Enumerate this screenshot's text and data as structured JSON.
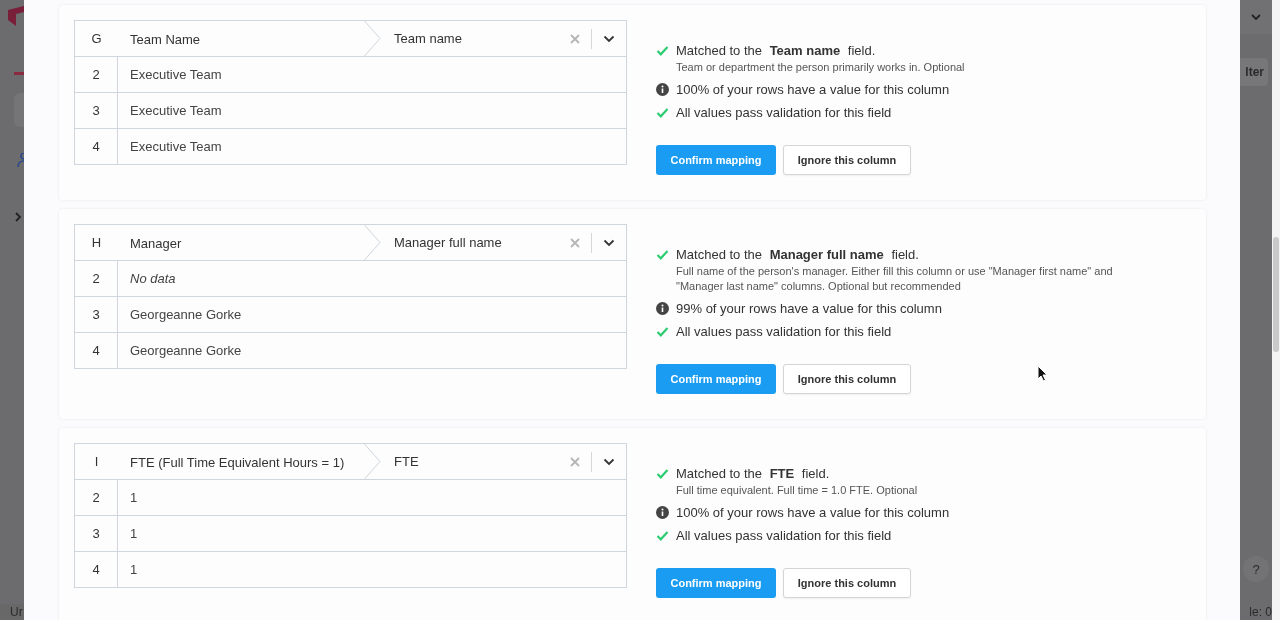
{
  "backdrop": {
    "filter_button": "lter",
    "footer_left": "Ur",
    "footer_right": "le: 0",
    "help_button": "?"
  },
  "mappings": [
    {
      "letter": "G",
      "source_header": "Team Name",
      "target": "Team name",
      "rows": [
        {
          "index": "2",
          "value": "Executive Team",
          "empty": false
        },
        {
          "index": "3",
          "value": "Executive Team",
          "empty": false
        },
        {
          "index": "4",
          "value": "Executive Team",
          "empty": false
        }
      ],
      "checks": [
        {
          "kind": "matched",
          "text": "Matched to the **Team name** field.",
          "description": "Team or department the person primarily works in. Optional"
        },
        {
          "kind": "info",
          "text": "100% of your rows have a value for this column"
        },
        {
          "kind": "valid",
          "text": "All values pass validation for this field"
        }
      ],
      "confirm_button": "Confirm mapping",
      "ignore_button": "Ignore this column"
    },
    {
      "letter": "H",
      "source_header": "Manager",
      "target": "Manager full name",
      "rows": [
        {
          "index": "2",
          "value": "No data",
          "empty": true
        },
        {
          "index": "3",
          "value": "Georgeanne Gorke",
          "empty": false
        },
        {
          "index": "4",
          "value": "Georgeanne Gorke",
          "empty": false
        }
      ],
      "checks": [
        {
          "kind": "matched",
          "text": "Matched to the **Manager full name** field.",
          "description": "Full name of the person's manager. Either fill this column or use \"Manager first name\" and \"Manager last name\" columns. Optional but recommended"
        },
        {
          "kind": "info",
          "text": "99% of your rows have a value for this column"
        },
        {
          "kind": "valid",
          "text": "All values pass validation for this field"
        }
      ],
      "confirm_button": "Confirm mapping",
      "ignore_button": "Ignore this column"
    },
    {
      "letter": "I",
      "source_header": "FTE (Full Time Equivalent Hours = 1)",
      "target": "FTE",
      "rows": [
        {
          "index": "2",
          "value": "1",
          "empty": false
        },
        {
          "index": "3",
          "value": "1",
          "empty": false
        },
        {
          "index": "4",
          "value": "1",
          "empty": false
        }
      ],
      "checks": [
        {
          "kind": "matched",
          "text": "Matched to the **FTE** field.",
          "description": "Full time equivalent. Full time = 1.0 FTE. Optional"
        },
        {
          "kind": "info",
          "text": "100% of your rows have a value for this column"
        },
        {
          "kind": "valid",
          "text": "All values pass validation for this field"
        }
      ],
      "confirm_button": "Confirm mapping",
      "ignore_button": "Ignore this column"
    }
  ]
}
